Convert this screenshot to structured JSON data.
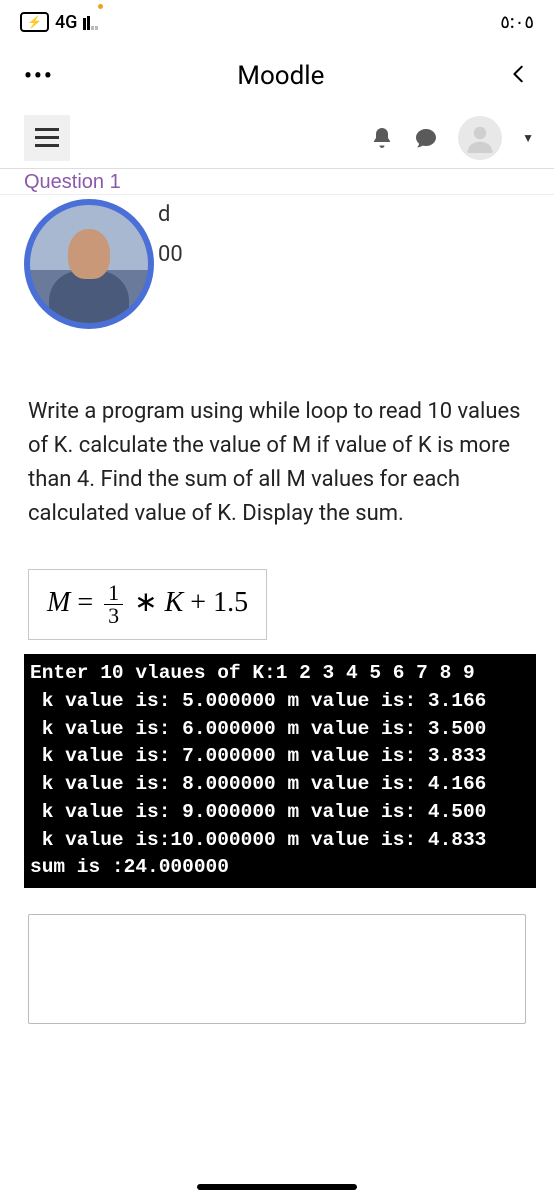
{
  "status": {
    "network": "4G",
    "time": "٥:٠٥"
  },
  "header": {
    "more": "•••",
    "title": "Moodle"
  },
  "question_label": "Question 1",
  "partial": {
    "line1": "d",
    "line2": "00"
  },
  "question_text": "Write a program using while loop to read 10 values of K.  calculate the value of M   if value of K is more than 4. Find the sum of all  M values  for each calculated value of K. Display the sum.",
  "formula": {
    "lhs": "M",
    "eq": "=",
    "num": "1",
    "den": "3",
    "star": "∗",
    "k": "K",
    "plus": "+ 1.5"
  },
  "terminal": {
    "line1": "Enter 10 vlaues of K:1 2 3 4 5 6 7 8 9 ",
    "line2": " k value is: 5.000000 m value is: 3.166",
    "line3": " k value is: 6.000000 m value is: 3.500",
    "line4": " k value is: 7.000000 m value is: 3.833",
    "line5": " k value is: 8.000000 m value is: 4.166",
    "line6": " k value is: 9.000000 m value is: 4.500",
    "line7": " k value is:10.000000 m value is: 4.833",
    "line8": "sum is :24.000000"
  }
}
